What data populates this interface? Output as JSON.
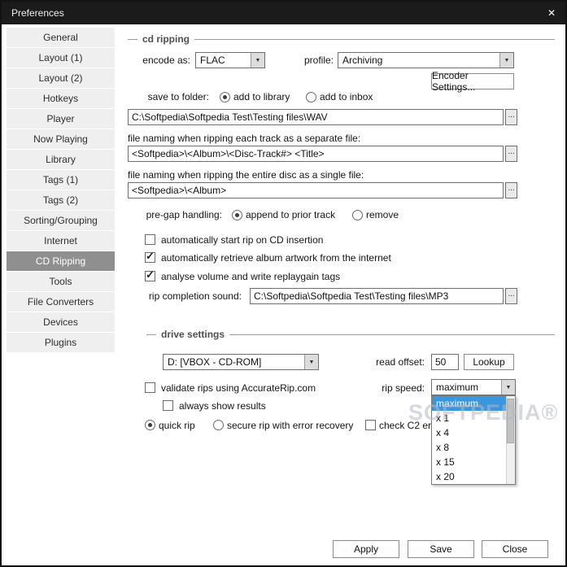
{
  "window": {
    "title": "Preferences"
  },
  "icons": {
    "close": "✕",
    "dropdown_arrow": "▼",
    "check": "✓"
  },
  "sidebar": {
    "items": [
      "General",
      "Layout (1)",
      "Layout (2)",
      "Hotkeys",
      "Player",
      "Now Playing",
      "Library",
      "Tags (1)",
      "Tags (2)",
      "Sorting/Grouping",
      "Internet",
      "CD Ripping",
      "Tools",
      "File Converters",
      "Devices",
      "Plugins"
    ],
    "selected": "CD Ripping"
  },
  "cd": {
    "section_title": "cd ripping",
    "encode_as_label": "encode as:",
    "encode_as_value": "FLAC",
    "profile_label": "profile:",
    "profile_value": "Archiving",
    "encoder_settings_button": "Encoder Settings...",
    "save_to_folder_label": "save to folder:",
    "add_to_library_label": "add to library",
    "add_to_inbox_label": "add to inbox",
    "folder_path": "C:\\Softpedia\\Softpedia Test\\Testing files\\WAV",
    "browse_label": "...",
    "track_naming_label": "file naming when ripping each track as a separate file:",
    "track_naming_value": "<Softpedia>\\<Album>\\<Disc-Track#> <Title>",
    "disc_naming_label": "file naming when ripping the entire disc as a single file:",
    "disc_naming_value": "<Softpedia>\\<Album>",
    "pregap_label": "pre-gap handling:",
    "pregap_append_label": "append to prior track",
    "pregap_remove_label": "remove",
    "auto_start_label": "automatically start rip on CD insertion",
    "auto_artwork_label": "automatically retrieve album artwork from the internet",
    "replaygain_label": "analyse volume and write replaygain tags",
    "rip_sound_label": "rip completion sound:",
    "rip_sound_value": "C:\\Softpedia\\Softpedia Test\\Testing files\\MP3"
  },
  "drive": {
    "section_title": "drive settings",
    "drive_value": "D: [VBOX - CD-ROM]",
    "read_offset_label": "read offset:",
    "read_offset_value": "50",
    "lookup_button": "Lookup",
    "validate_label": "validate rips using AccurateRip.com",
    "always_show_results_label": "always show results",
    "rip_speed_label": "rip speed:",
    "rip_speed_value": "maximum",
    "rip_speed_options": [
      "maximum",
      "x 1",
      "x 4",
      "x 8",
      "x 15",
      "x 20"
    ],
    "quick_rip_label": "quick rip",
    "secure_rip_label": "secure rip with error recovery",
    "check_c2_label": "check C2 err"
  },
  "footer": {
    "apply": "Apply",
    "save": "Save",
    "close": "Close"
  },
  "watermark": "SOFTPEDIA®"
}
